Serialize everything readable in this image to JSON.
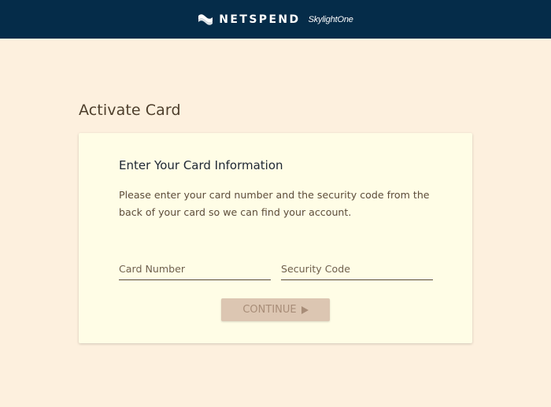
{
  "header": {
    "brand": "NETSPEND",
    "sub_brand": "SkylightOne",
    "background": "#052c49"
  },
  "page": {
    "title": "Activate Card",
    "background": "#fdf0de"
  },
  "card": {
    "heading": "Enter Your Card Information",
    "description": "Please enter your card number and the security code from the back of your card so we can find your account.",
    "background": "#fffde6",
    "fields": {
      "card_number": {
        "placeholder": "Card Number",
        "value": ""
      },
      "security_code": {
        "placeholder": "Security Code",
        "value": ""
      }
    },
    "continue_button": {
      "label": "CONTINUE",
      "icon": "play-arrow-icon",
      "background": "#dcc6b2"
    }
  }
}
